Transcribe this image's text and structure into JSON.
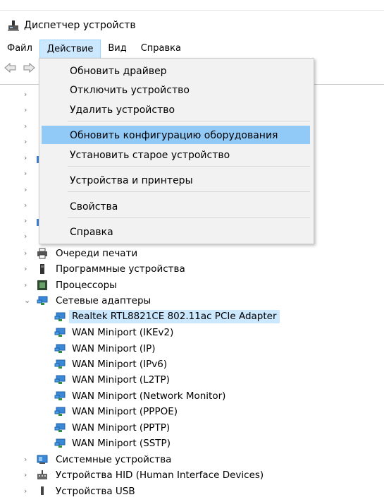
{
  "window": {
    "title": "Диспетчер устройств"
  },
  "menubar": {
    "items": [
      "Файл",
      "Действие",
      "Вид",
      "Справка"
    ]
  },
  "dropdown": {
    "items": [
      "Обновить драйвер",
      "Отключить устройство",
      "Удалить устройство",
      "Обновить конфигурацию оборудования",
      "Установить старое устройство",
      "Устройства и принтеры",
      "Свойства",
      "Справка"
    ]
  },
  "tree": {
    "print_queues": "Очереди печати",
    "software_devices": "Программные устройства",
    "processors": "Процессоры",
    "network_adapters": "Сетевые адаптеры",
    "adapters": [
      "Realtek RTL8821CE 802.11ac PCIe Adapter",
      "WAN Miniport (IKEv2)",
      "WAN Miniport (IP)",
      "WAN Miniport (IPv6)",
      "WAN Miniport (L2TP)",
      "WAN Miniport (Network Monitor)",
      "WAN Miniport (PPPOE)",
      "WAN Miniport (PPTP)",
      "WAN Miniport (SSTP)"
    ],
    "system_devices": "Системные устройства",
    "hid_devices": "Устройства HID (Human Interface Devices)",
    "usb_devices": "Устройства USB"
  },
  "colors": {
    "selection": "#cce8ff",
    "menu_highlight": "#91c9f7",
    "menu_bg": "#f2f2f2"
  }
}
